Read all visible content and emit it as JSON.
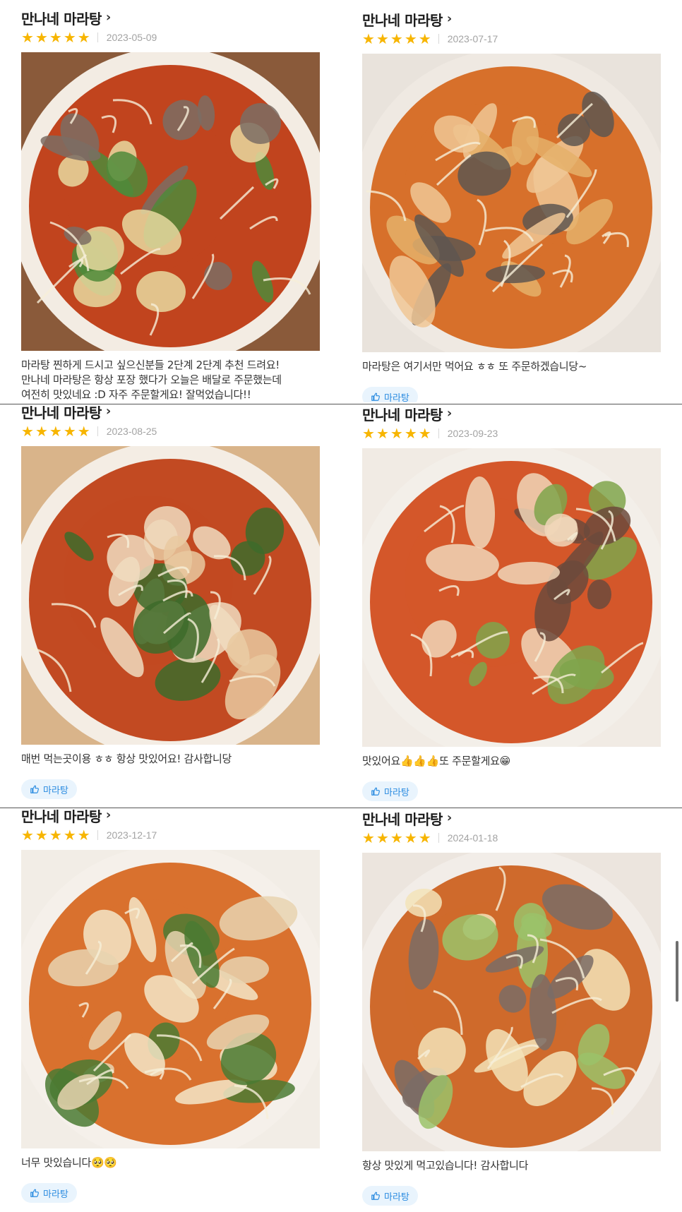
{
  "reviews": [
    {
      "store": "만나네 마라탕",
      "rating": 5,
      "date": "2023-05-09",
      "text": "마라탕 찐하게 드시고 싶으신분들 2단계 2단계 추천 드려요!\n만나네 마라탕은 항상 포장 했다가 오늘은 배달로 주문했는데\n여전히 맛있네요 :D 자주 주문할게요! 잘먹었습니다!!",
      "tag": "",
      "photo_icon": "malatang-photo"
    },
    {
      "store": "만나네 마라탕",
      "rating": 5,
      "date": "2023-07-17",
      "text": "마라탕은 여기서만 먹어요 ㅎㅎ 또 주문하겠습니당~",
      "tag": "마라탕",
      "photo_icon": "malatang-photo"
    },
    {
      "store": "만나네 마라탕",
      "rating": 5,
      "date": "2023-08-25",
      "text": "매번 먹는곳이용 ㅎㅎ 항상 맛있어요! 감사합니당",
      "tag": "마라탕",
      "photo_icon": "malatang-photo"
    },
    {
      "store": "만나네 마라탕",
      "rating": 5,
      "date": "2023-09-23",
      "text": "맛있어요👍👍👍또 주문할게요😁",
      "tag": "마라탕",
      "photo_icon": "malatang-photo"
    },
    {
      "store": "만나네 마라탕",
      "rating": 5,
      "date": "2023-12-17",
      "text": "너무 맛있습니다🥺🥺",
      "tag": "마라탕",
      "photo_icon": "malatang-photo"
    },
    {
      "store": "만나네 마라탕",
      "rating": 5,
      "date": "2024-01-18",
      "text": "항상 맛있게 먹고있습니다! 감사합니다",
      "tag": "마라탕",
      "photo_icon": "malatang-photo"
    }
  ],
  "colors": {
    "star": "#f7b500",
    "tag_bg": "#e9f4fd",
    "tag_text": "#2a8be0",
    "date": "#a3a3a3"
  }
}
